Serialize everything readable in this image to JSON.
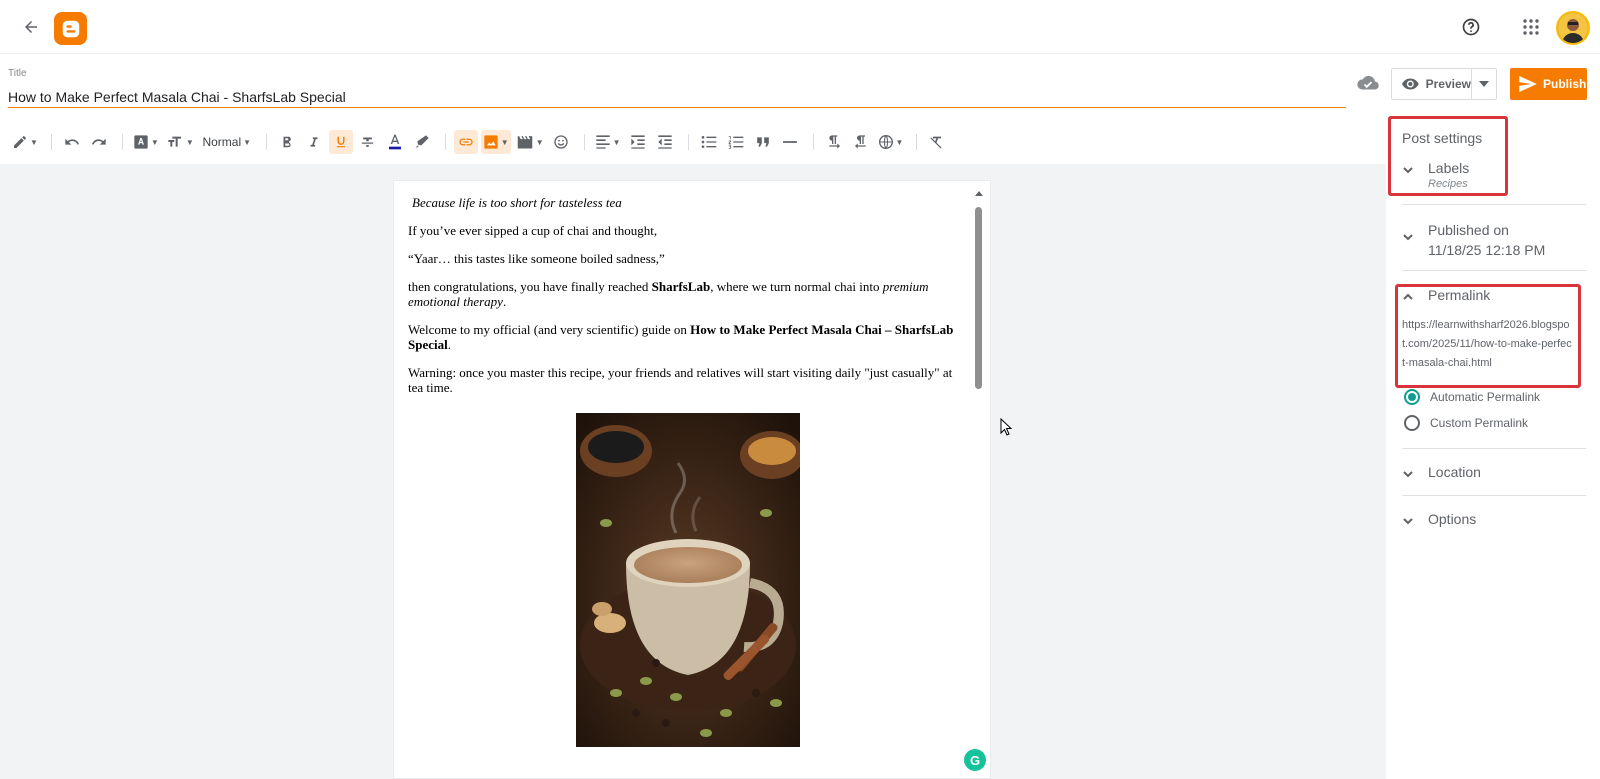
{
  "header": {
    "back_icon": "arrow-left-icon",
    "logo_icon": "blogger-logo-icon",
    "help_icon": "help-circle-icon",
    "apps_icon": "apps-grid-icon",
    "avatar_icon": "user-avatar-icon",
    "brand_color": "#f57c00"
  },
  "title": {
    "label": "Title",
    "value": "How to Make Perfect Masala Chai - SharfsLab Special"
  },
  "actions": {
    "preview_label": "Preview",
    "publish_label": "Publish"
  },
  "toolbar": {
    "format_label": "Normal"
  },
  "document": {
    "tagline": "Because life is too short for tasteless tea",
    "p1": "If you’ve ever sipped a cup of chai and thought,",
    "p2": "“Yaar… this tastes like someone boiled sadness,”",
    "p3_a": "then congratulations, you have finally reached ",
    "p3_b": "SharfsLab",
    "p3_c": ", where we turn normal chai into ",
    "p3_d": "premium emotional therapy",
    "p3_e": ".",
    "p4_a": "Welcome to my official (and very scientific) guide on ",
    "p4_b": "How to Make Perfect Masala Chai – SharfsLab Special",
    "p4_c": ".",
    "p5": "Warning: once you master this recipe, your friends and relatives will start visiting daily \"just casually\" at tea time.",
    "grammarly_letter": "G"
  },
  "panel": {
    "post_settings": "Post settings",
    "labels": {
      "title": "Labels",
      "value": "Recipes"
    },
    "published": {
      "title": "Published on",
      "value": "11/18/25 12:18 PM"
    },
    "permalink": {
      "title": "Permalink",
      "url": "https://learnwithsharf2026.blogspot.com/2025/11/how-to-make-perfect-masala-chai.html",
      "option_auto": "Automatic Permalink",
      "option_custom": "Custom Permalink"
    },
    "location": "Location",
    "options": "Options",
    "highlight_color": "#d9343c",
    "radio_color": "#0f9d8f"
  }
}
